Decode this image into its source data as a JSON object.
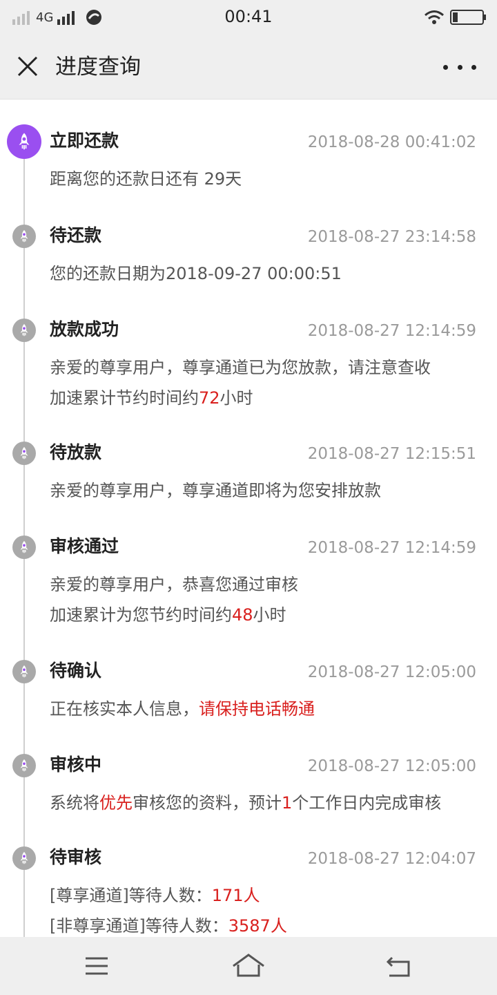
{
  "status_bar": {
    "network": "4G",
    "time": "00:41"
  },
  "header": {
    "title": "进度查询",
    "close_icon": "close-icon",
    "more_icon": "more-horizontal-icon"
  },
  "timeline": [
    {
      "icon": "rocket-icon",
      "active": true,
      "title": "立即还款",
      "time": "2018-08-28 00:41:02",
      "lines": [
        [
          "距离您的还款日还有 29天"
        ]
      ]
    },
    {
      "icon": "rocket-icon",
      "active": false,
      "title": "待还款",
      "time": "2018-08-27 23:14:58",
      "lines": [
        [
          "您的还款日期为2018-09-27 00:00:51"
        ]
      ]
    },
    {
      "icon": "rocket-icon",
      "active": false,
      "title": "放款成功",
      "time": "2018-08-27 12:14:59",
      "lines": [
        [
          "亲爱的尊享用户，尊享通道已为您放款，请注意查收"
        ],
        [
          "加速累计节约时间约",
          "72",
          "小时"
        ]
      ]
    },
    {
      "icon": "rocket-icon",
      "active": false,
      "title": "待放款",
      "time": "2018-08-27 12:15:51",
      "lines": [
        [
          "亲爱的尊享用户，尊享通道即将为您安排放款"
        ]
      ]
    },
    {
      "icon": "rocket-icon",
      "active": false,
      "title": "审核通过",
      "time": "2018-08-27 12:14:59",
      "lines": [
        [
          "亲爱的尊享用户，恭喜您通过审核"
        ],
        [
          "加速累计为您节约时间约",
          "48",
          "小时"
        ]
      ]
    },
    {
      "icon": "rocket-icon",
      "active": false,
      "title": "待确认",
      "time": "2018-08-27 12:05:00",
      "lines": [
        [
          "正在核实本人信息，",
          "请保持电话畅通"
        ]
      ]
    },
    {
      "icon": "rocket-icon",
      "active": false,
      "title": "审核中",
      "time": "2018-08-27 12:05:00",
      "lines": [
        [
          "系统将",
          "优先",
          "审核您的资料，预计",
          "1",
          "个工作日内完成审核"
        ]
      ]
    },
    {
      "icon": "rocket-icon",
      "active": false,
      "title": "待审核",
      "time": "2018-08-27 12:04:07",
      "lines": [
        [
          "[尊享通道]等待人数：",
          "171人"
        ],
        [
          "[非尊享通道]等待人数：",
          "3587人"
        ]
      ]
    }
  ],
  "colors": {
    "accent": "#9a4ff0",
    "highlight": "#d9201e",
    "inactive_icon": "#a9a9a9",
    "timestamp": "#9a9a9a"
  },
  "bottom_nav": {
    "menu_icon": "menu-icon",
    "home_icon": "home-icon",
    "back_icon": "back-icon"
  }
}
